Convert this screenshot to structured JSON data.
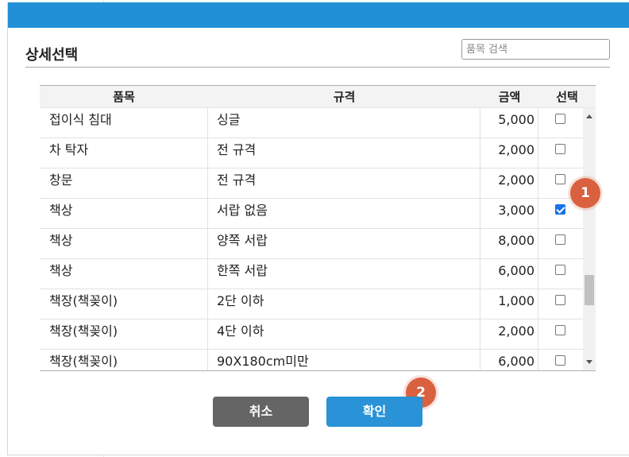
{
  "dialog": {
    "title": "상세선택",
    "search_placeholder": "품목 검색"
  },
  "table": {
    "headers": {
      "item": "품목",
      "spec": "규격",
      "price": "금액",
      "select": "선택"
    },
    "rows": [
      {
        "item": "접이식 침대",
        "spec": "싱글",
        "price": "5,000",
        "checked": false
      },
      {
        "item": "차 탁자",
        "spec": "전 규격",
        "price": "2,000",
        "checked": false
      },
      {
        "item": "창문",
        "spec": "전 규격",
        "price": "2,000",
        "checked": false
      },
      {
        "item": "책상",
        "spec": "서랍 없음",
        "price": "3,000",
        "checked": true
      },
      {
        "item": "책상",
        "spec": "양쪽 서랍",
        "price": "8,000",
        "checked": false
      },
      {
        "item": "책상",
        "spec": "한쪽 서랍",
        "price": "6,000",
        "checked": false
      },
      {
        "item": "책장(책꽂이)",
        "spec": "2단 이하",
        "price": "1,000",
        "checked": false
      },
      {
        "item": "책장(책꽂이)",
        "spec": "4단 이하",
        "price": "2,000",
        "checked": false
      },
      {
        "item": "책장(책꽂이)",
        "spec": "90X180cm미만",
        "price": "6,000",
        "checked": false
      }
    ]
  },
  "markers": {
    "one": "1",
    "two": "2"
  },
  "buttons": {
    "cancel": "취소",
    "confirm": "확인"
  },
  "colors": {
    "header_bar": "#2190d6",
    "confirm_button": "#2a92d6",
    "cancel_button": "#656565",
    "marker": "#d9613f"
  }
}
